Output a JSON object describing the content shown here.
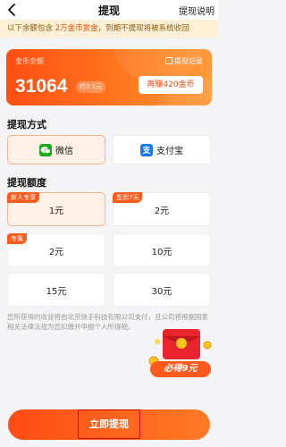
{
  "header": {
    "title": "提现",
    "right_link": "提现说明"
  },
  "notice": {
    "prefix": "以下余额包含 ",
    "highlight": "2万金币赏金",
    "suffix": "，到期不提现将被系统收回"
  },
  "balance": {
    "label": "金币余额",
    "records": "提现记录",
    "amount": "31064",
    "approx": "约3.1元",
    "earn_button": "再赚420金币"
  },
  "method_section": {
    "title": "提现方式",
    "methods": [
      {
        "label": "微信",
        "icon": "wechat-icon",
        "selected": true
      },
      {
        "label": "支付宝",
        "icon": "alipay-icon",
        "selected": false
      }
    ]
  },
  "amount_section": {
    "title": "提现额度",
    "options": [
      {
        "label": "1元",
        "tag": "新人专享",
        "selected": true
      },
      {
        "label": "2元",
        "tag": "签到7天",
        "selected": false
      },
      {
        "label": "2元",
        "tag": "专属",
        "selected": false
      },
      {
        "label": "10元",
        "tag": "",
        "selected": false
      },
      {
        "label": "15元",
        "tag": "",
        "selected": false
      },
      {
        "label": "30元",
        "tag": "",
        "selected": false
      }
    ]
  },
  "disclaimer": "您所获得的收益将由北京快手科技有限公司支付，且公司将根据国家相关法律法规为您扣缴并申报个人所得税。",
  "promo": {
    "label": "必得9元"
  },
  "withdraw_button": "立即提现",
  "colors": {
    "accent": "#ff5b1a",
    "notice_bg": "#fff0d6",
    "selected_bg": "#fff1e8"
  }
}
